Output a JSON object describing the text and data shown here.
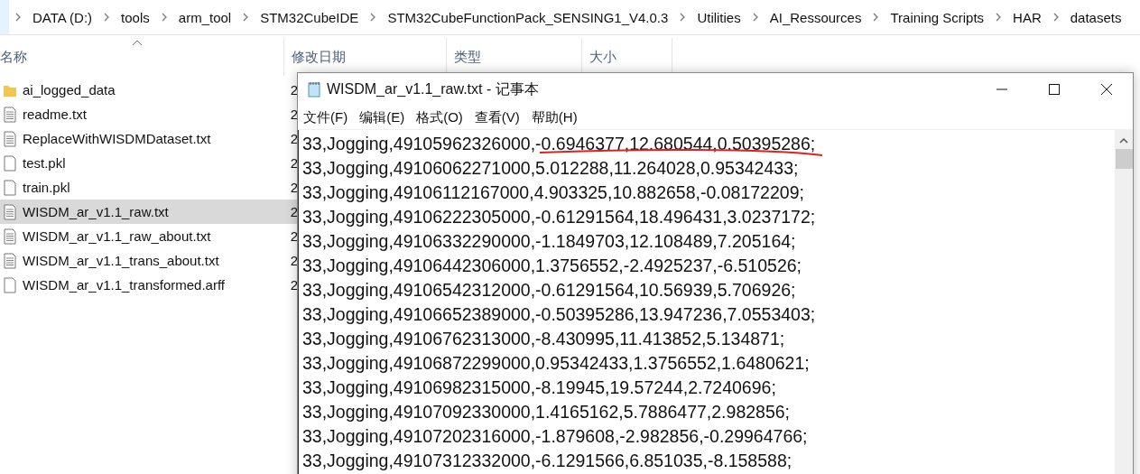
{
  "breadcrumb": [
    "DATA (D:)",
    "tools",
    "arm_tool",
    "STM32CubeIDE",
    "STM32CubeFunctionPack_SENSING1_V4.0.3",
    "Utilities",
    "AI_Ressources",
    "Training Scripts",
    "HAR",
    "datasets"
  ],
  "columns": [
    "名称",
    "修改日期",
    "类型",
    "大小"
  ],
  "files": [
    {
      "name": "ai_logged_data",
      "kind": "folder",
      "date": "2",
      "selected": false
    },
    {
      "name": "readme.txt",
      "kind": "text",
      "date": "2",
      "selected": false
    },
    {
      "name": "ReplaceWithWISDMDataset.txt",
      "kind": "text",
      "date": "2",
      "selected": false
    },
    {
      "name": "test.pkl",
      "kind": "blank",
      "date": "2",
      "selected": false
    },
    {
      "name": "train.pkl",
      "kind": "blank",
      "date": "2",
      "selected": false
    },
    {
      "name": "WISDM_ar_v1.1_raw.txt",
      "kind": "text",
      "date": "2",
      "selected": true
    },
    {
      "name": "WISDM_ar_v1.1_raw_about.txt",
      "kind": "text",
      "date": "2",
      "selected": false
    },
    {
      "name": "WISDM_ar_v1.1_trans_about.txt",
      "kind": "text",
      "date": "2",
      "selected": false
    },
    {
      "name": "WISDM_ar_v1.1_transformed.arff",
      "kind": "blank",
      "date": "2",
      "selected": false
    }
  ],
  "notepad": {
    "title": "WISDM_ar_v1.1_raw.txt - 记事本",
    "menu": [
      "文件(F)",
      "编辑(E)",
      "格式(O)",
      "查看(V)",
      "帮助(H)"
    ],
    "lines": [
      {
        "text": "33,Jogging,49105962326000,-0.6946377,12.680544,0.50395286;",
        "underlined": true
      },
      {
        "text": "33,Jogging,49106062271000,5.012288,11.264028,0.95342433;",
        "underlined": false
      },
      {
        "text": "33,Jogging,49106112167000,4.903325,10.882658,-0.08172209;",
        "underlined": false
      },
      {
        "text": "33,Jogging,49106222305000,-0.61291564,18.496431,3.0237172;",
        "underlined": false
      },
      {
        "text": "33,Jogging,49106332290000,-1.1849703,12.108489,7.205164;",
        "underlined": false
      },
      {
        "text": "33,Jogging,49106442306000,1.3756552,-2.4925237,-6.510526;",
        "underlined": false
      },
      {
        "text": "33,Jogging,49106542312000,-0.61291564,10.56939,5.706926;",
        "underlined": false
      },
      {
        "text": "33,Jogging,49106652389000,-0.50395286,13.947236,7.0553403;",
        "underlined": false
      },
      {
        "text": "33,Jogging,49106762313000,-8.430995,11.413852,5.134871;",
        "underlined": false
      },
      {
        "text": "33,Jogging,49106872299000,0.95342433,1.3756552,1.6480621;",
        "underlined": false
      },
      {
        "text": "33,Jogging,49106982315000,-8.19945,19.57244,2.7240696;",
        "underlined": false
      },
      {
        "text": "33,Jogging,49107092330000,1.4165162,5.7886477,2.982856;",
        "underlined": false
      },
      {
        "text": "33,Jogging,49107202316000,-1.879608,-2.982856,-0.29964766;",
        "underlined": false
      },
      {
        "text": "33,Jogging,49107312332000,-6.1291566,6.851035,-8.158588;",
        "underlined": false
      }
    ]
  }
}
